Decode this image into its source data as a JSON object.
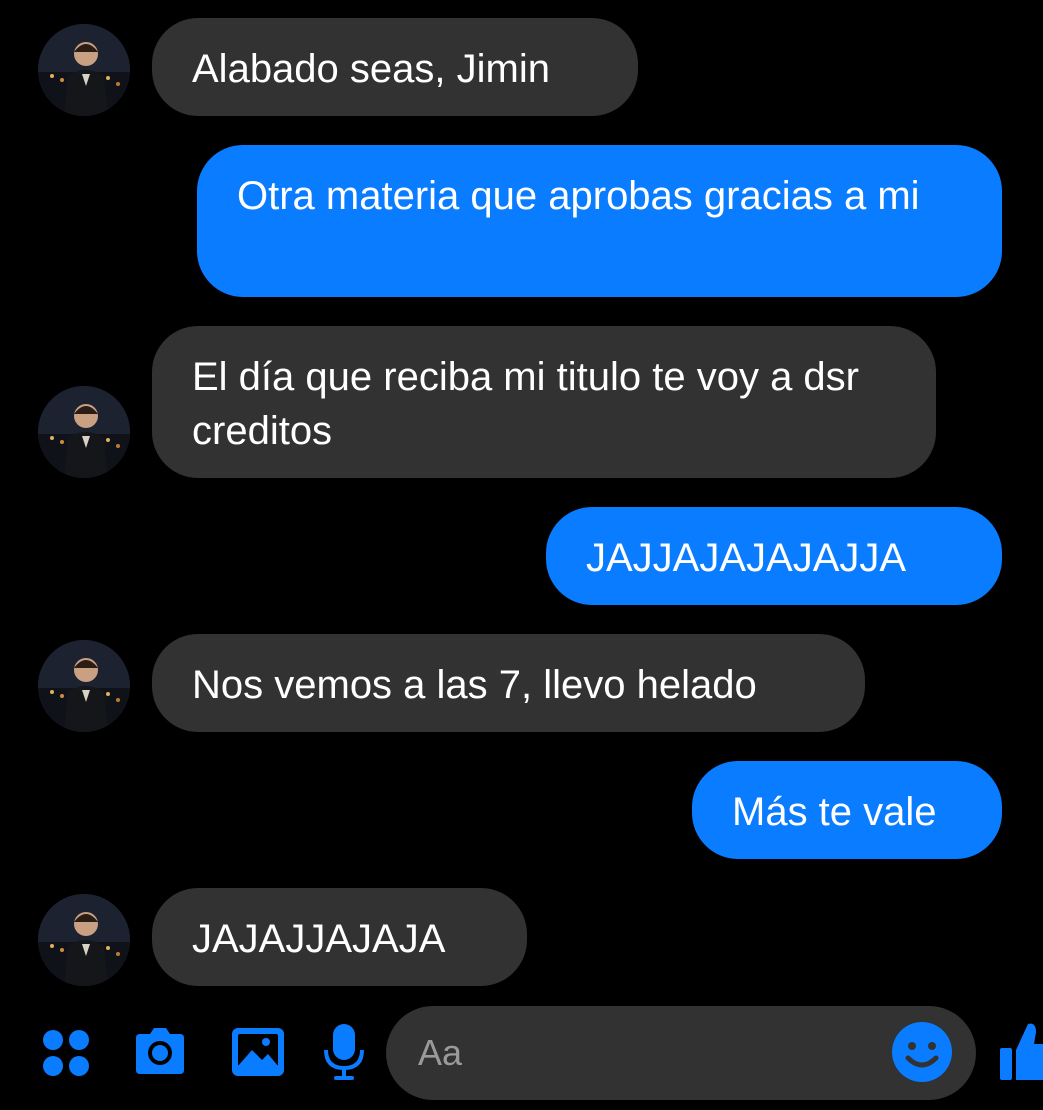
{
  "conversation": {
    "messages": [
      {
        "from": "contact",
        "text": "Alabado seas, Jimin"
      },
      {
        "from": "me",
        "text": "Otra materia que aprobas gracias a mi"
      },
      {
        "from": "contact",
        "text": "El día que reciba mi titulo te voy a dsr creditos"
      },
      {
        "from": "me",
        "text": "JAJJAJAJAJAJJA"
      },
      {
        "from": "contact",
        "text": "Nos vemos a las 7, llevo helado"
      },
      {
        "from": "me",
        "text": "Más te vale"
      },
      {
        "from": "contact",
        "text": "JAJAJJAJAJA"
      }
    ]
  },
  "composer": {
    "placeholder": "Aa",
    "icons": [
      "apps-icon",
      "camera-icon",
      "gallery-icon",
      "microphone-icon",
      "emoji-icon",
      "thumbs-up-icon"
    ]
  },
  "colors": {
    "background": "#000000",
    "incoming_bubble": "#323233",
    "outgoing_bubble": "#0a7cff",
    "accent": "#0a7cff",
    "text": "#ffffff",
    "placeholder": "#9a9a9a"
  }
}
